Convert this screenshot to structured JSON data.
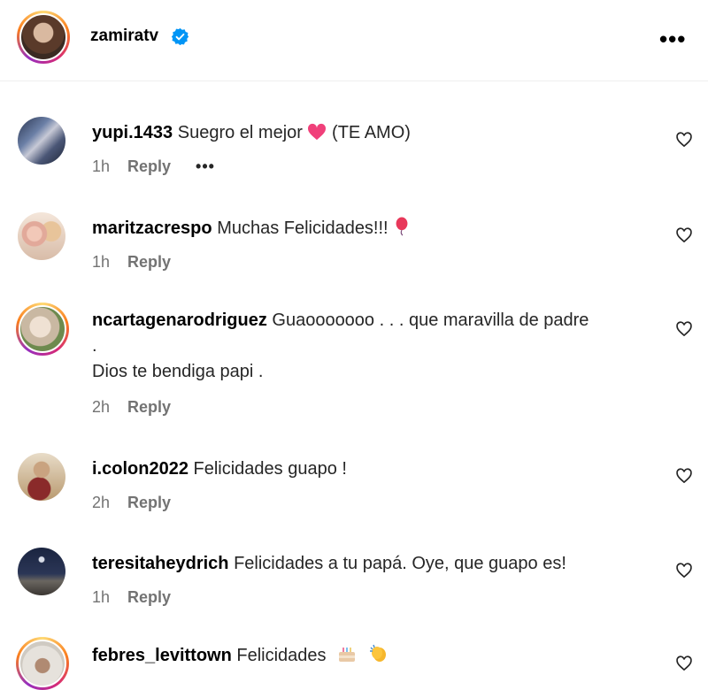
{
  "header": {
    "username": "zamiratv",
    "verified_icon": "verified-badge-icon",
    "more_icon": "more-horizontal-icon",
    "more_label": "•••"
  },
  "comments": [
    {
      "username": "yupi.1433",
      "text": "Suegro el mejor",
      "text_after": "(TE AMO)",
      "emoji": "pink-heart",
      "time": "1h",
      "reply": "Reply",
      "more": "•••"
    },
    {
      "username": "maritzacrespo",
      "text": "Muchas Felicidades!!!",
      "emoji": "balloon",
      "time": "1h",
      "reply": "Reply"
    },
    {
      "username": "ncartagenarodriguez",
      "text": "Guaooooooo . . . que maravilla de padre",
      "line2": ".",
      "line3": "Dios te bendiga papi .",
      "time": "2h",
      "reply": "Reply"
    },
    {
      "username": "i.colon2022",
      "text": "Felicidades guapo !",
      "time": "2h",
      "reply": "Reply"
    },
    {
      "username": "teresitaheydrich",
      "text": "Felicidades a tu papá. Oye, que guapo es!",
      "time": "1h",
      "reply": "Reply"
    },
    {
      "username": "febres_levittown",
      "text": "Felicidades",
      "emoji": "birthday-cake clapping-hands",
      "time": "",
      "reply": ""
    }
  ],
  "colors": {
    "text_primary": "#000000",
    "text_secondary": "#737373",
    "verified": "#0095f6",
    "divider": "#efefef"
  }
}
